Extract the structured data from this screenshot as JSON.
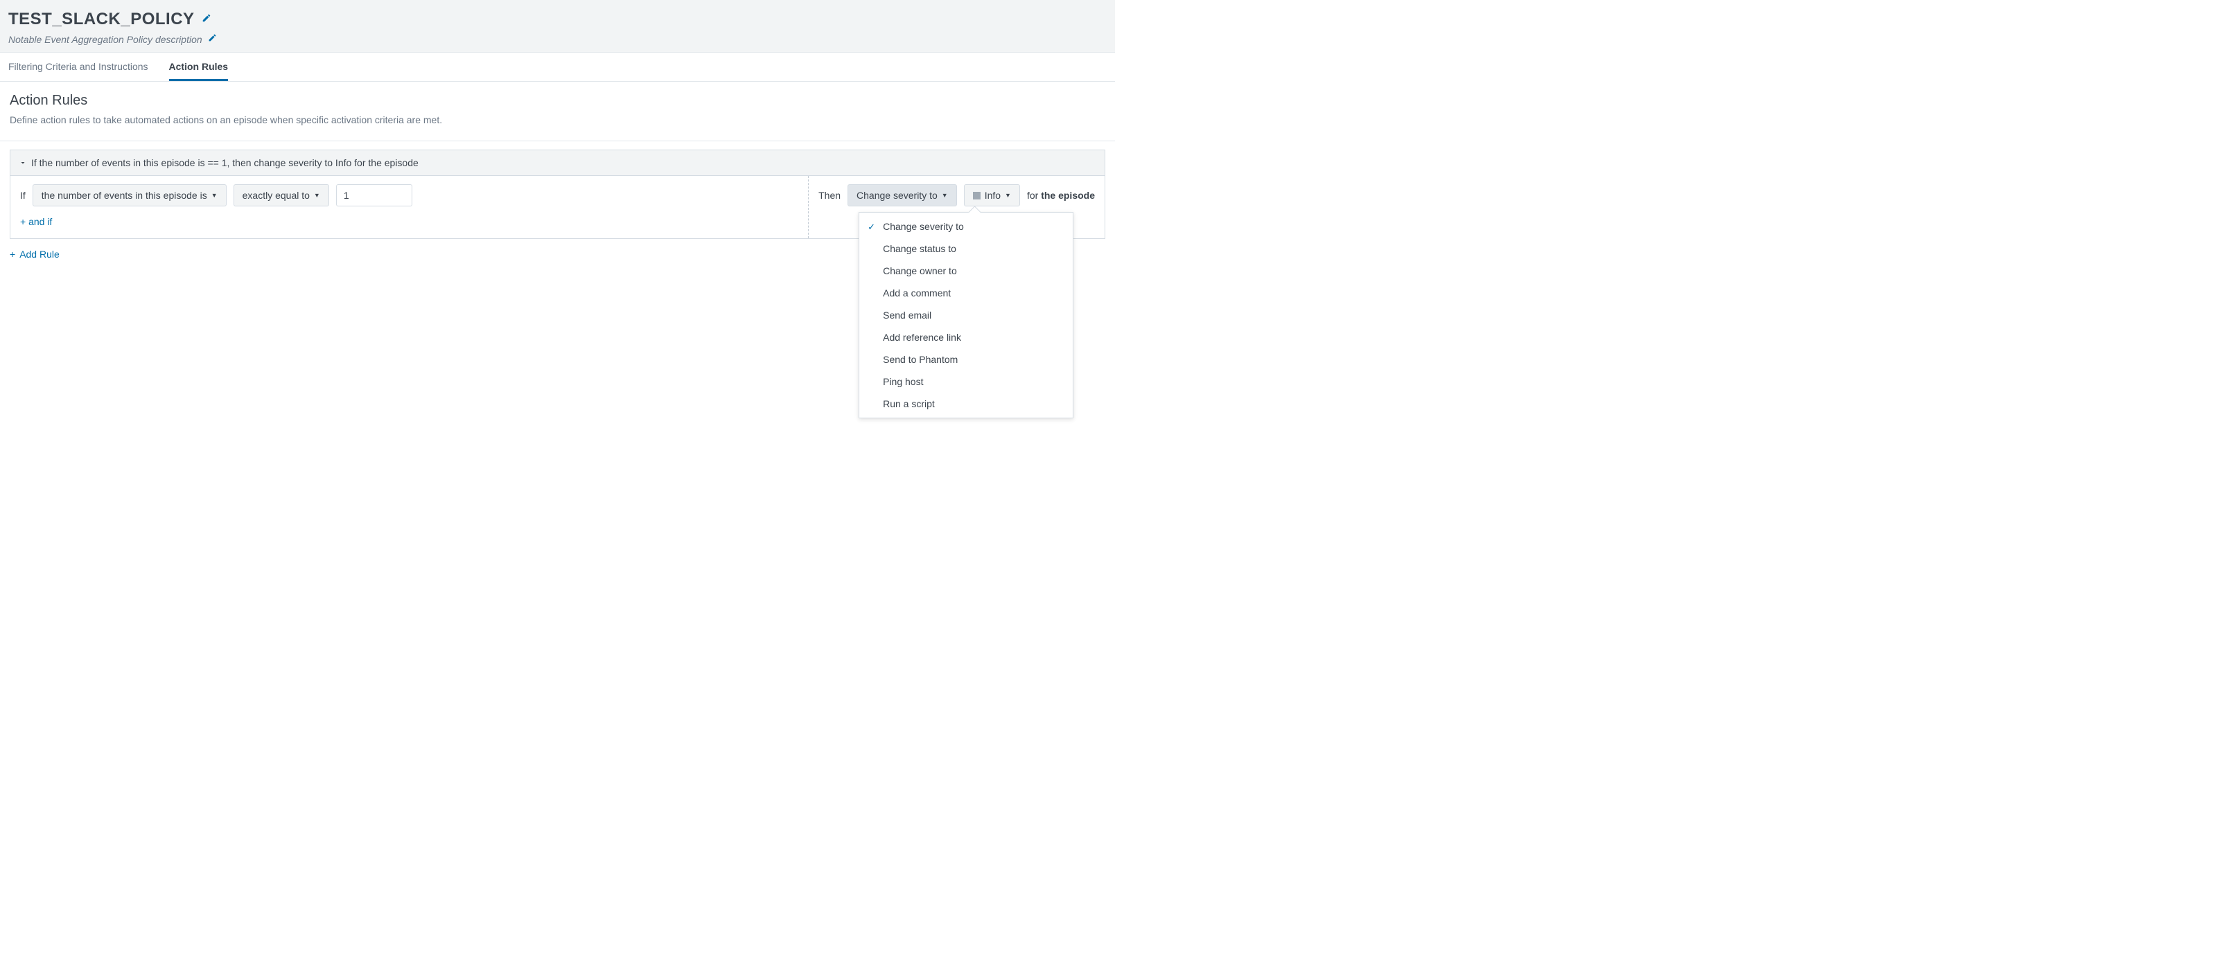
{
  "header": {
    "title": "TEST_SLACK_POLICY",
    "description": "Notable Event Aggregation Policy description"
  },
  "tabs": [
    {
      "label": "Filtering Criteria and Instructions",
      "active": false
    },
    {
      "label": "Action Rules",
      "active": true
    }
  ],
  "section": {
    "title": "Action Rules",
    "description": "Define action rules to take automated actions on an episode when specific activation criteria are met."
  },
  "rule": {
    "summary": "If the number of events in this episode is == 1, then change severity to Info for the episode",
    "if_label": "If",
    "condition_field": "the number of events in this episode is",
    "operator": "exactly equal to",
    "value": "1",
    "and_if_label": "+ and if",
    "then_label": "Then",
    "action_selected": "Change severity to",
    "severity_selected": "Info",
    "for_label": "for",
    "for_target": "the episode"
  },
  "action_menu": {
    "items": [
      {
        "label": "Change severity to",
        "selected": true
      },
      {
        "label": "Change status to",
        "selected": false
      },
      {
        "label": "Change owner to",
        "selected": false
      },
      {
        "label": "Add a comment",
        "selected": false
      },
      {
        "label": "Send email",
        "selected": false
      },
      {
        "label": "Add reference link",
        "selected": false
      },
      {
        "label": "Send to Phantom",
        "selected": false
      },
      {
        "label": "Ping host",
        "selected": false
      },
      {
        "label": "Run a script",
        "selected": false
      }
    ]
  },
  "add_rule_label": "Add Rule"
}
